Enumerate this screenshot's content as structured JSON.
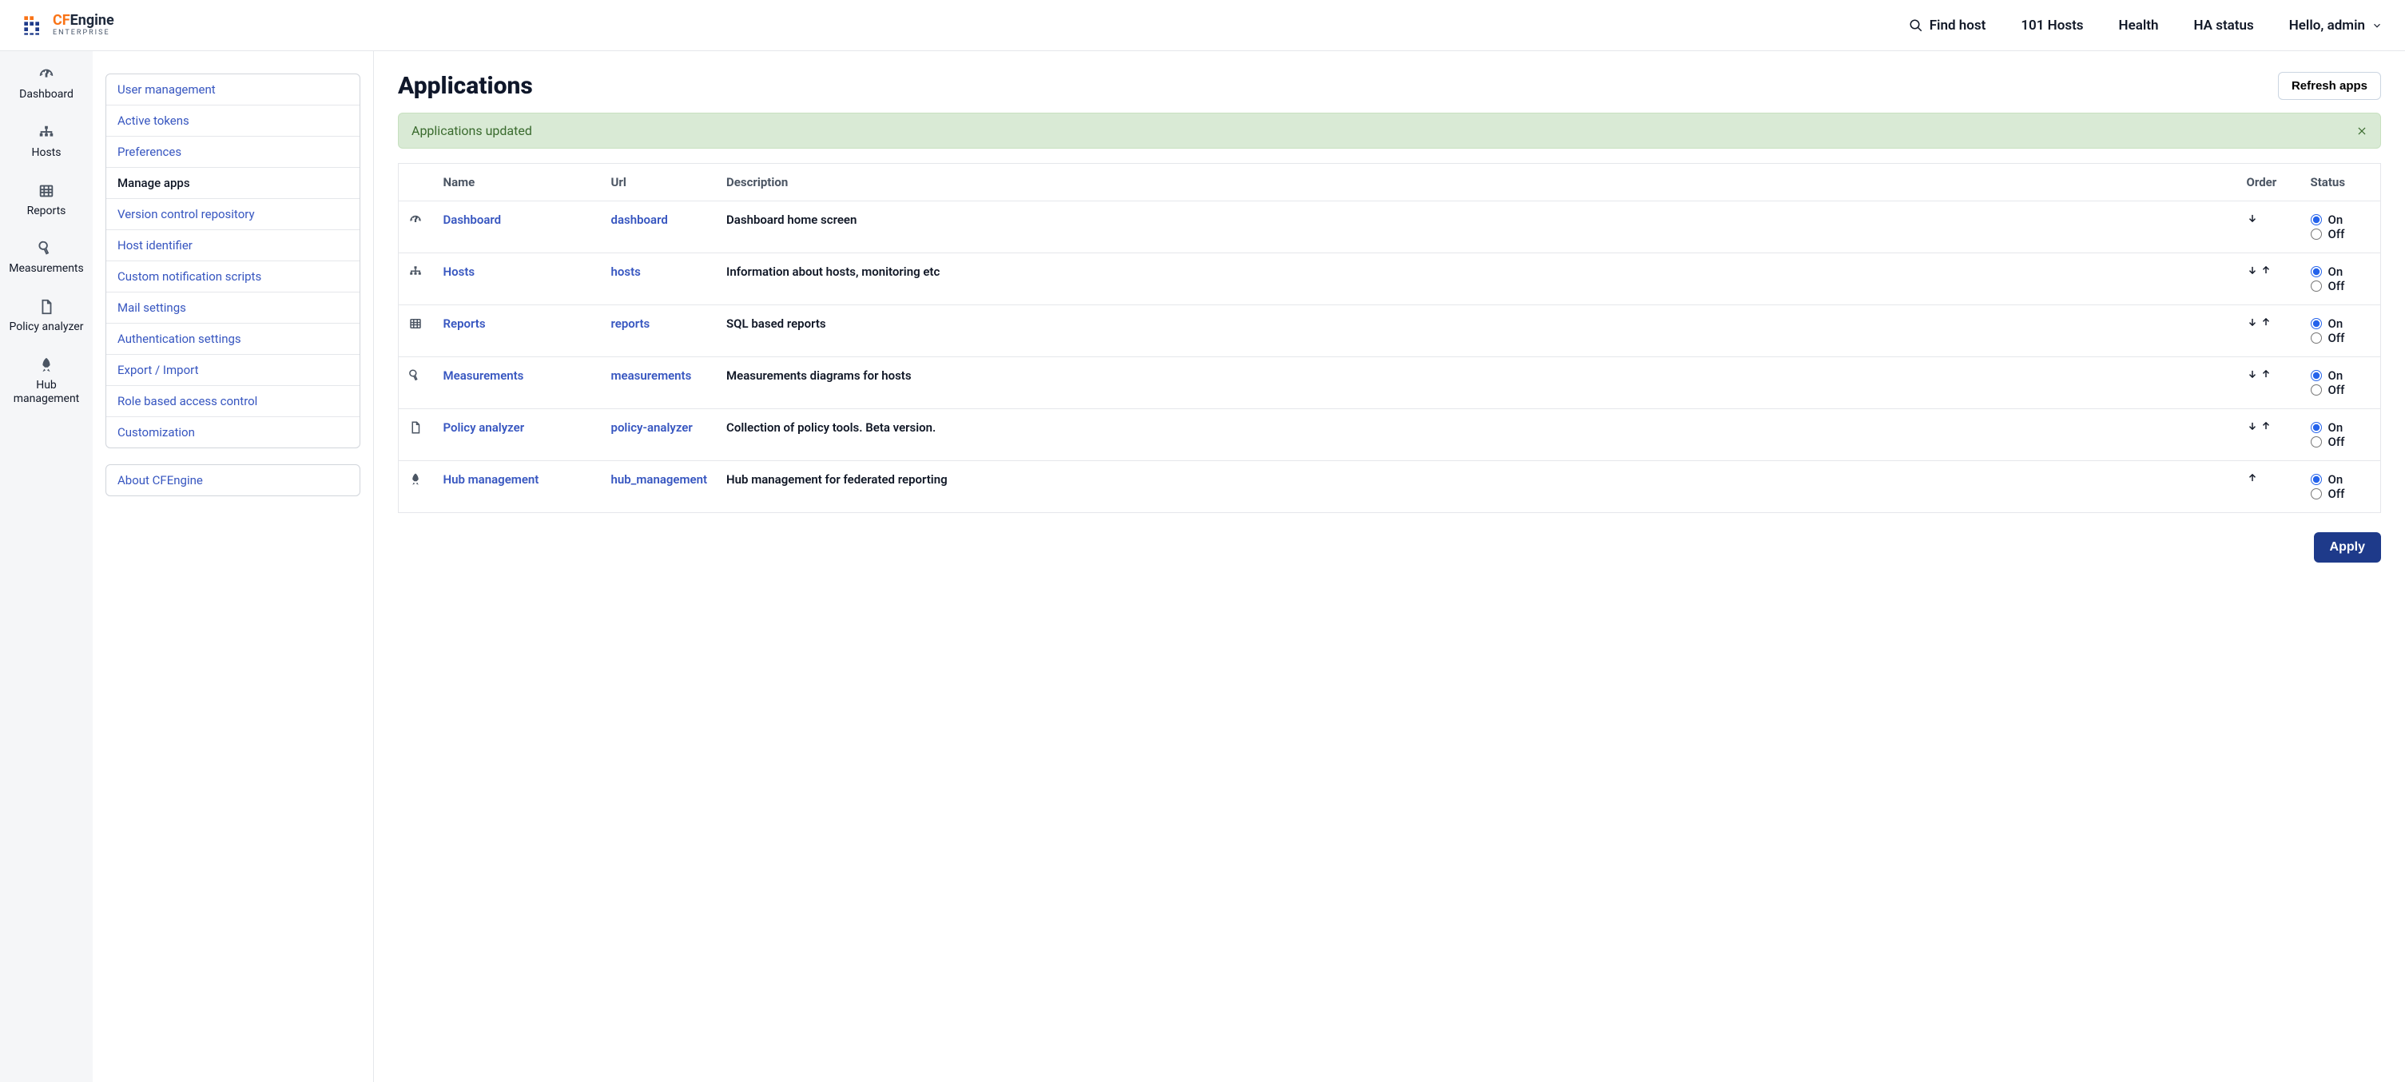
{
  "brand": {
    "cf": "CF",
    "engine": "Engine",
    "sub": "ENTERPRISE"
  },
  "topnav": {
    "find_host": "Find host",
    "hosts_count": "101 Hosts",
    "health": "Health",
    "ha_status": "HA status",
    "greeting": "Hello, admin"
  },
  "leftnav": [
    {
      "icon": "dashboard-icon",
      "label": "Dashboard"
    },
    {
      "icon": "hosts-icon",
      "label": "Hosts"
    },
    {
      "icon": "reports-icon",
      "label": "Reports"
    },
    {
      "icon": "measure-icon",
      "label": "Measurements"
    },
    {
      "icon": "file-icon",
      "label": "Policy analyzer"
    },
    {
      "icon": "rocket-icon",
      "label": "Hub management"
    }
  ],
  "settings_menu": [
    "User management",
    "Active tokens",
    "Preferences",
    "Manage apps",
    "Version control repository",
    "Host identifier",
    "Custom notification scripts",
    "Mail settings",
    "Authentication settings",
    "Export / Import",
    "Role based access control",
    "Customization"
  ],
  "settings_active_index": 3,
  "about_label": "About CFEngine",
  "page": {
    "title": "Applications",
    "refresh_label": "Refresh apps",
    "alert": "Applications updated",
    "apply_label": "Apply",
    "columns": {
      "name": "Name",
      "url": "Url",
      "description": "Description",
      "order": "Order",
      "status": "Status"
    },
    "status_labels": {
      "on": "On",
      "off": "Off"
    }
  },
  "applications": [
    {
      "icon": "dashboard-icon",
      "name": "Dashboard",
      "url": "dashboard",
      "description": "Dashboard home screen",
      "can_up": false,
      "can_down": true,
      "status": "on"
    },
    {
      "icon": "hosts-icon",
      "name": "Hosts",
      "url": "hosts",
      "description": "Information about hosts, monitoring etc",
      "can_up": true,
      "can_down": true,
      "status": "on"
    },
    {
      "icon": "reports-icon",
      "name": "Reports",
      "url": "reports",
      "description": "SQL based reports",
      "can_up": true,
      "can_down": true,
      "status": "on"
    },
    {
      "icon": "measure-icon",
      "name": "Measurements",
      "url": "measurements",
      "description": "Measurements diagrams for hosts",
      "can_up": true,
      "can_down": true,
      "status": "on"
    },
    {
      "icon": "file-icon",
      "name": "Policy analyzer",
      "url": "policy-analyzer",
      "description": "Collection of policy tools. Beta version.",
      "can_up": true,
      "can_down": true,
      "status": "on"
    },
    {
      "icon": "rocket-icon",
      "name": "Hub management",
      "url": "hub_management",
      "description": "Hub management for federated reporting",
      "can_up": true,
      "can_down": false,
      "status": "on"
    }
  ]
}
